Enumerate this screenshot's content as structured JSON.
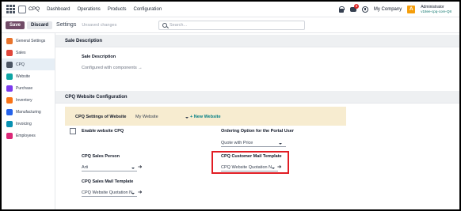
{
  "nav": {
    "app_name": "CPQ",
    "menu": [
      "Dashboard",
      "Operations",
      "Products",
      "Configuration"
    ],
    "badge_count": "3",
    "company": "My Company",
    "avatar_letter": "A",
    "user_name": "Administrator",
    "user_db": "v18ee-cpq-core-Q8"
  },
  "control": {
    "save_label": "Save",
    "discard_label": "Discard",
    "breadcrumb": "Settings",
    "status": "Unsaved changes",
    "search_placeholder": "Search..."
  },
  "sidebar": {
    "items": [
      {
        "label": "General Settings",
        "icon": "gear-icon",
        "color": "#e8732c"
      },
      {
        "label": "Sales",
        "icon": "sales-icon",
        "color": "#e0463a"
      },
      {
        "label": "CPQ",
        "icon": "cpq-icon",
        "color": "#4b5563"
      },
      {
        "label": "Website",
        "icon": "website-icon",
        "color": "#0ea5a4"
      },
      {
        "label": "Purchase",
        "icon": "purchase-icon",
        "color": "#7c3aed"
      },
      {
        "label": "Inventory",
        "icon": "inventory-icon",
        "color": "#f97316"
      },
      {
        "label": "Manufacturing",
        "icon": "manufacturing-icon",
        "color": "#2563eb"
      },
      {
        "label": "Invoicing",
        "icon": "invoicing-icon",
        "color": "#0891b2"
      },
      {
        "label": "Employees",
        "icon": "employees-icon",
        "color": "#db2777"
      }
    ],
    "active_index": 2
  },
  "sale_desc": {
    "header": "Sale Description",
    "field_label": "Sale Description",
    "field_value": "Configured with components →"
  },
  "cpq_website": {
    "header": "CPQ Website Configuration",
    "settings_label": "CPQ Settings of Website",
    "website_value": "My Website",
    "new_website": "+ New Website",
    "enable_label": "Enable website CPQ",
    "ordering_label": "Ordering Option for the Portal User",
    "ordering_value": "Quote with Price",
    "sales_person_label": "CPQ Sales Person",
    "sales_person_value": "Arti",
    "customer_mail_label": "CPQ Customer Mail Template",
    "customer_mail_value": "CPQ Website Quotation N",
    "sales_mail_label": "CPQ Sales Mail Template",
    "sales_mail_value": "CPQ Website Quotation N"
  },
  "colors": {
    "brand": "#714b67",
    "highlight": "#e11d24",
    "accent_link": "#017e84"
  }
}
